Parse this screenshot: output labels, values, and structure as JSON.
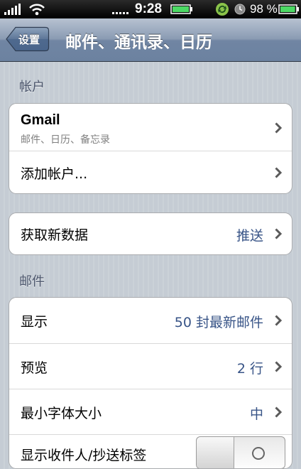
{
  "status_bar": {
    "time": "9:28",
    "battery_percent": "98 %",
    "battery_level": 0.98
  },
  "nav": {
    "back_label": "设置",
    "title": "邮件、通讯录、日历"
  },
  "accounts_section": {
    "header": "帐户",
    "gmail": {
      "title": "Gmail",
      "subtitle": "邮件、日历、备忘录"
    },
    "add_account": "添加帐户..."
  },
  "fetch_section": {
    "label": "获取新数据",
    "value": "推送"
  },
  "mail_section": {
    "header": "邮件",
    "rows": [
      {
        "label": "显示",
        "value": "50 封最新邮件"
      },
      {
        "label": "预览",
        "value": "2 行"
      },
      {
        "label": "最小字体大小",
        "value": "中"
      }
    ],
    "toggle_row": {
      "label": "显示收件人/抄送标签",
      "state": "off"
    }
  },
  "colors": {
    "value_text": "#385487",
    "section_header": "#4c566c",
    "background": "#c5ccd4",
    "navbar": "#6c82a0",
    "battery": "#4cd964"
  },
  "icons": [
    "signal-icon",
    "wifi-icon",
    "carrier-dots-icon",
    "battery-small-icon",
    "sync-icon",
    "clock-icon",
    "battery-icon",
    "chevron-right-icon",
    "back-arrow-icon"
  ]
}
